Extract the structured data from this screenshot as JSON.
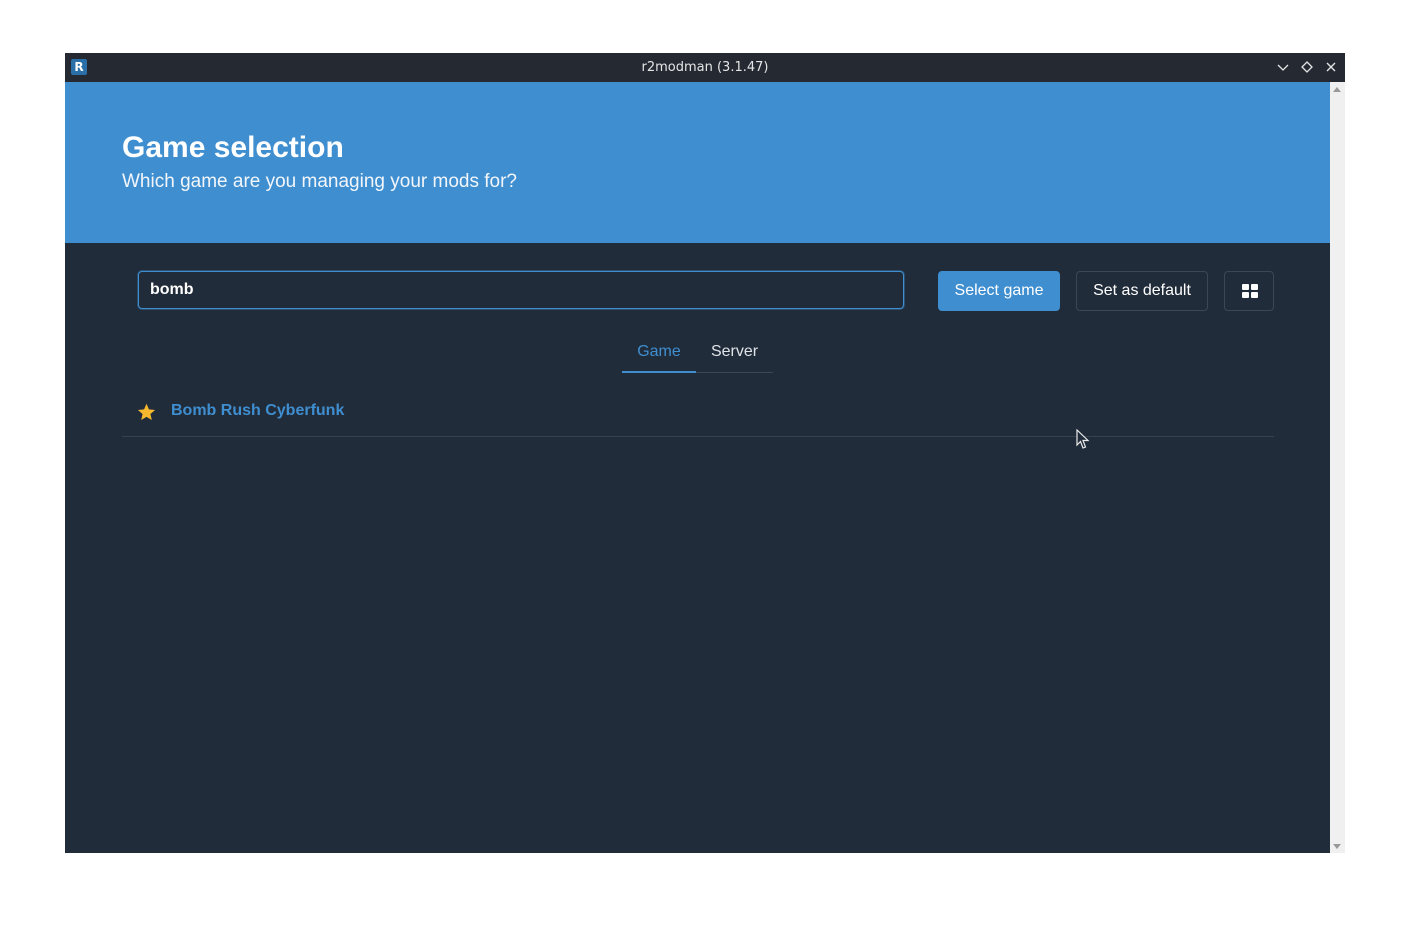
{
  "window": {
    "title": "r2modman (3.1.47)",
    "app_icon_letter": "R"
  },
  "hero": {
    "title": "Game selection",
    "subtitle": "Which game are you managing your mods for?"
  },
  "search": {
    "value": "bomb",
    "placeholder": ""
  },
  "buttons": {
    "select_game": "Select game",
    "set_default": "Set as default",
    "view_toggle_icon": "grid-view-icon"
  },
  "tabs": [
    {
      "label": "Game",
      "active": true
    },
    {
      "label": "Server",
      "active": false
    }
  ],
  "games": [
    {
      "name": "Bomb Rush Cyberfunk",
      "favorite": true
    }
  ],
  "colors": {
    "accent": "#3e8ed0",
    "background": "#212c3a",
    "favorite_star": "#f5b82e"
  }
}
